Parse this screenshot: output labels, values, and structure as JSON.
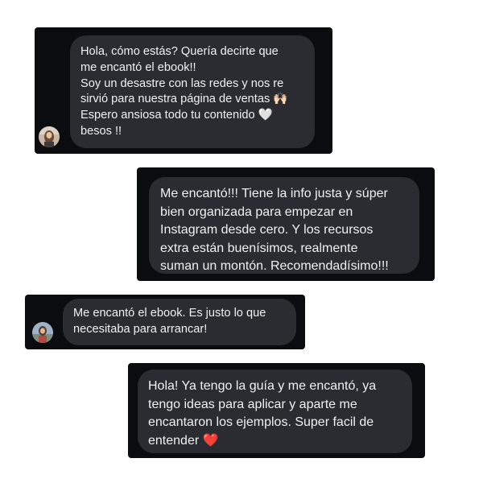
{
  "messages": [
    {
      "text": "Hola, cómo estás? Quería decirte que\nme encantó el ebook!!\nSoy un desastre con las redes y nos re\nsirvió para nuestra página de ventas 🙌🏻\nEspero ansiosa todo tu contenido 🤍\nbesos !!",
      "avatar": "avatar-photo"
    },
    {
      "text": "Me encantó!!! Tiene la info justa y súper\nbien organizada para empezar en\nInstagram desde cero. Y los recursos\nextra están buenísimos, realmente\nsuman un montón. Recomendadísimo!!!"
    },
    {
      "text": "Me encantó el ebook. Es justo lo que\nnecesitaba para arrancar!",
      "avatar": "avatar-photo"
    },
    {
      "text": "Hola! Ya tengo la guía y me encantó, ya\ntengo ideas para aplicar y aparte me\nencantaron los ejemplos. Super facil de\nentender ❤️"
    }
  ],
  "colors": {
    "page_background": "#ffffff",
    "card_background": "#0b0c10",
    "bubble_background": "#2a2c31",
    "bubble_text": "#f1f1f3"
  }
}
